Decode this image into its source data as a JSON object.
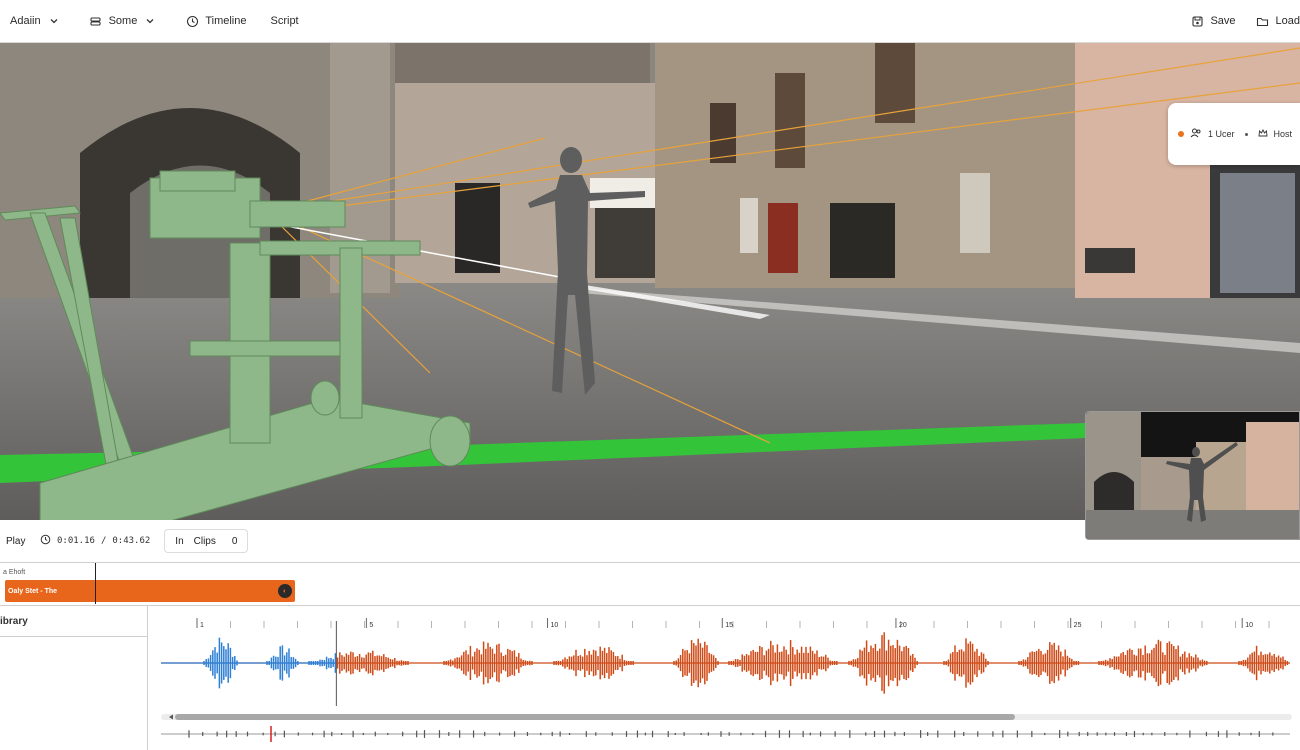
{
  "toolbar": {
    "admin_label": "Adaiin",
    "scene_label": "Some",
    "timeline_label": "Timeline",
    "script_label": "Script",
    "save_label": "Save",
    "load_label": "Load"
  },
  "presence": {
    "users_label": "1 Ucer",
    "host_label": "Host"
  },
  "transport": {
    "play_label": "Play",
    "current_time": "0:01.16",
    "separator": "/",
    "total_time": "0:43.62",
    "clips_icon_text": "In",
    "clips_label": "Clips",
    "clips_count": "0"
  },
  "timeline": {
    "shot_track_label": "a Ehoft",
    "shot_clip_label": "Oaly Stet - The",
    "library_label": "ibrary",
    "ruler_labels": [
      {
        "label": "1",
        "pos": 0.0
      },
      {
        "label": "5",
        "pos": 0.158
      },
      {
        "label": "10",
        "pos": 0.327
      },
      {
        "label": "15",
        "pos": 0.49
      },
      {
        "label": "20",
        "pos": 0.652
      },
      {
        "label": "25",
        "pos": 0.815
      },
      {
        "label": "10",
        "pos": 0.975
      }
    ],
    "playhead_time_fraction": 0.13
  },
  "colors": {
    "accent": "#e8661b",
    "audio_played": "#2d7fd6",
    "audio_unplayed": "#cf4a17",
    "dolly_green": "#8fb88a",
    "track_green": "#33c43a"
  },
  "icons": {
    "admin": "chevron-down-icon",
    "scene": "scene-icon",
    "timeline": "clock-icon",
    "save": "save-icon",
    "load": "folder-icon",
    "users": "users-icon",
    "host": "crown-icon",
    "timecode": "clock-icon",
    "clips": "film-icon"
  }
}
